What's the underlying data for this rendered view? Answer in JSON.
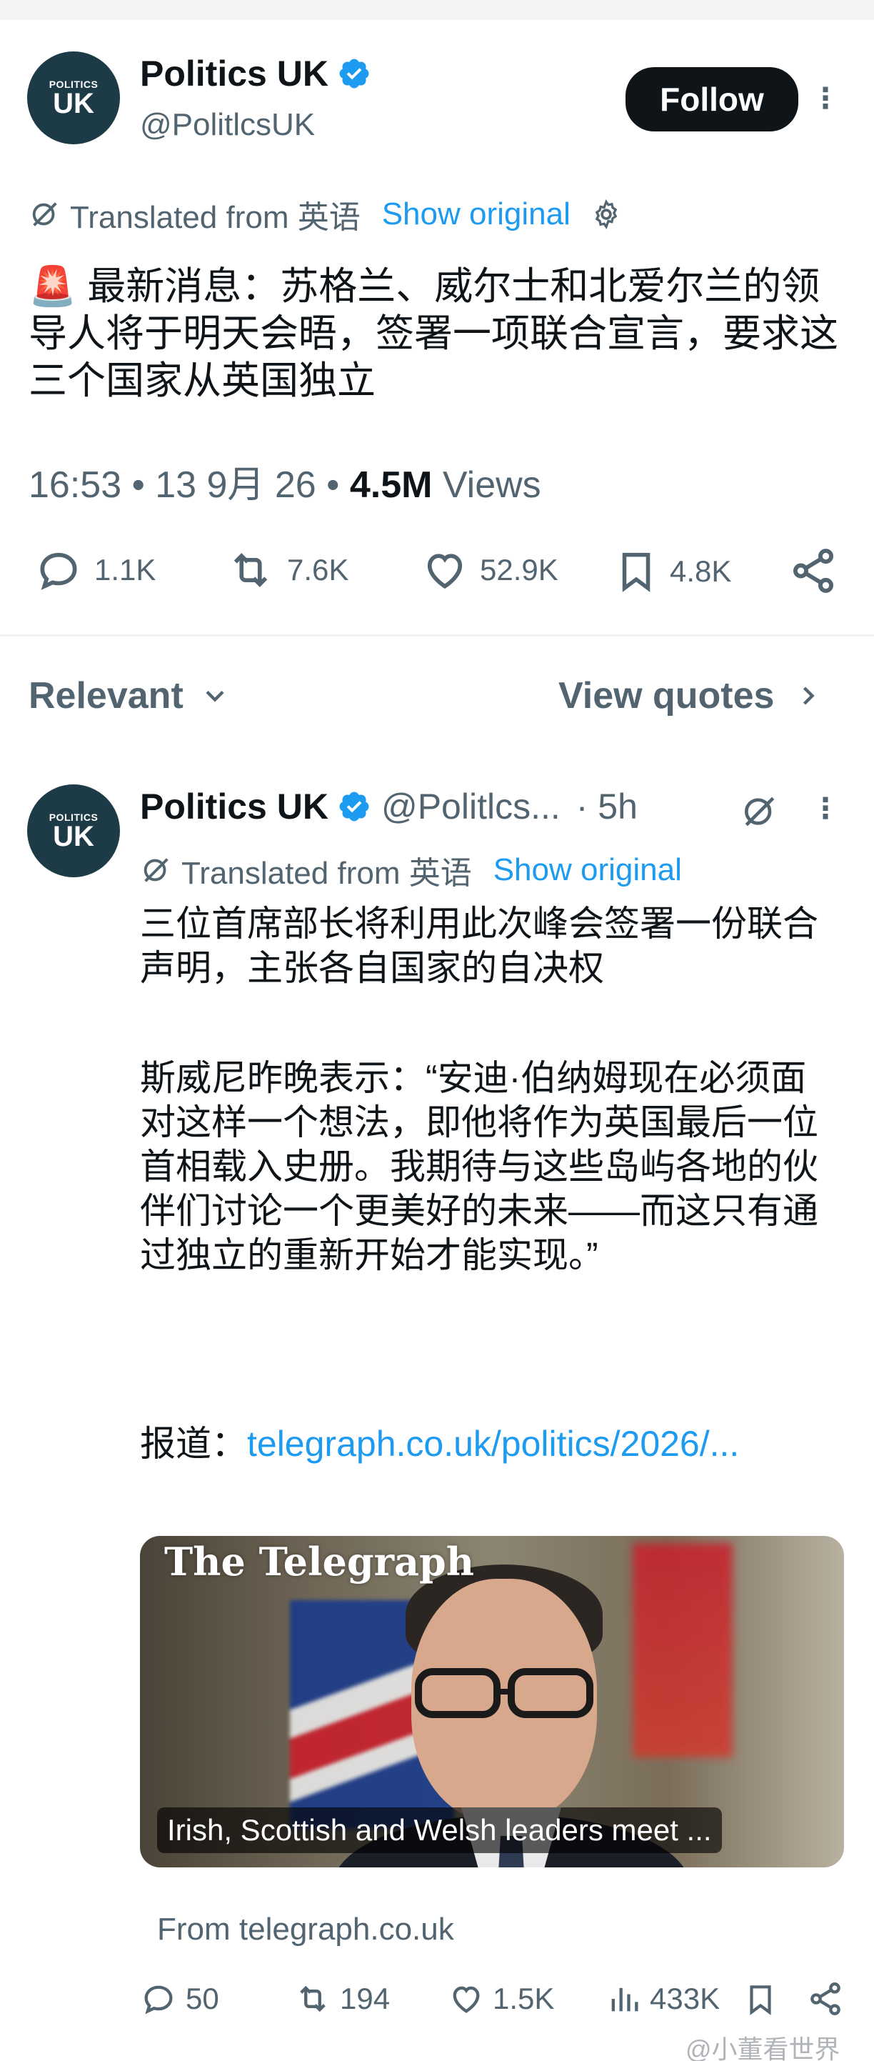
{
  "main_tweet": {
    "avatar_text_top": "POLITICS",
    "avatar_text_main": "UK",
    "author_name": "Politics UK",
    "author_handle": "@PolitlcsUK",
    "follow_label": "Follow",
    "more_label": "⋮",
    "translated_label": "Translated from 英语",
    "show_original_label": "Show original",
    "text": "🚨 最新消息：苏格兰、威尔士和北爱尔兰的领导人将于明天会晤，签署一项联合宣言，要求这三个国家从英国独立",
    "meta_time": "16:53 • 13 9月 26 •",
    "views_count": "4.5M",
    "views_label": "Views",
    "actions": {
      "replies": "1.1K",
      "retweets": "7.6K",
      "likes": "52.9K",
      "bookmarks": "4.8K"
    }
  },
  "sort_bar": {
    "relevant_label": "Relevant",
    "view_quotes_label": "View quotes"
  },
  "reply": {
    "avatar_text_top": "POLITICS",
    "avatar_text_main": "UK",
    "author_name": "Politics UK",
    "author_handle": "@Politlcs...",
    "time": "· 5h",
    "more_label": "⋮",
    "translated_label": "Translated from 英语",
    "show_original_label": "Show original",
    "para1": "三位首席部长将利用此次峰会签署一份联合声明，主张各自国家的自决权",
    "para2": "斯威尼昨晚表示：“安迪·伯纳姆现在必须面对这样一个想法，即他将作为英国最后一位首相载入史册。我期待与这些岛屿各地的伙伴们讨论一个更美好的未来——而这只有通过独立的重新开始才能实现。”",
    "report_prefix": "报道：",
    "report_link": "telegraph.co.uk/politics/2026/...",
    "card_logo": "The Telegraph",
    "card_caption": "Irish, Scottish and Welsh leaders meet ...",
    "card_from": "From telegraph.co.uk",
    "actions": {
      "replies": "50",
      "retweets": "194",
      "likes": "1.5K",
      "views": "433K"
    }
  },
  "watermark": "@小董看世界",
  "colors": {
    "accent": "#1d9bf0",
    "text": "#0f1419",
    "muted": "#536471",
    "avatar_bg": "#1d3b47"
  }
}
